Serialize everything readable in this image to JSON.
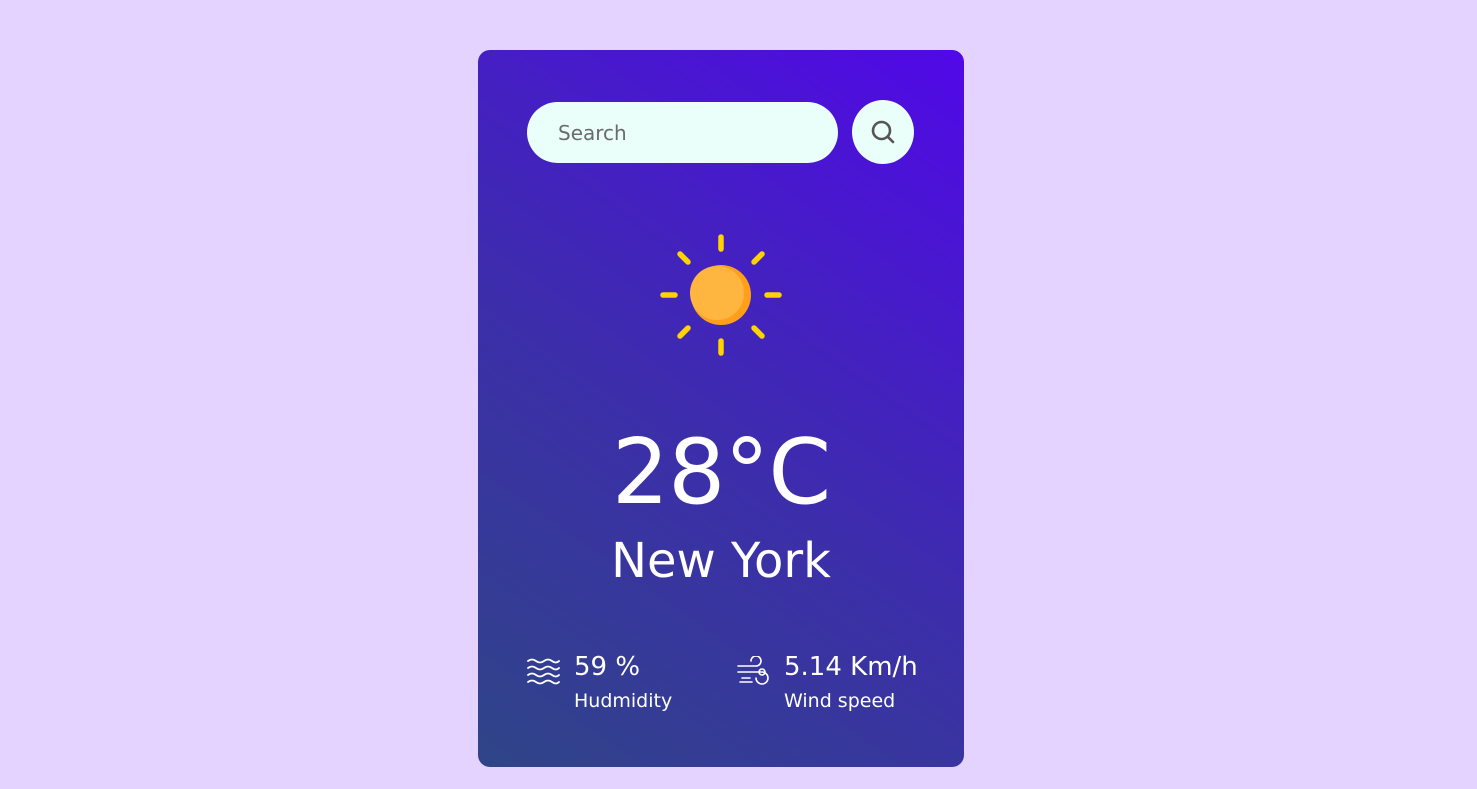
{
  "search": {
    "placeholder": "Search",
    "value": ""
  },
  "weather": {
    "icon": "sun-icon",
    "temperature": "28°C",
    "city": "New York"
  },
  "humidity": {
    "icon": "water-waves-icon",
    "value": "59 %",
    "label": "Hudmidity"
  },
  "wind": {
    "icon": "wind-icon",
    "value": "5.14 Km/h",
    "label": "Wind speed"
  },
  "colors": {
    "page_background": "#e3d3fe",
    "card_gradient_start": "#2f4587",
    "card_gradient_end": "#5108e8",
    "input_background": "#eafefa",
    "sun_core": "#ffb33a",
    "sun_rays": "#ffd200"
  }
}
